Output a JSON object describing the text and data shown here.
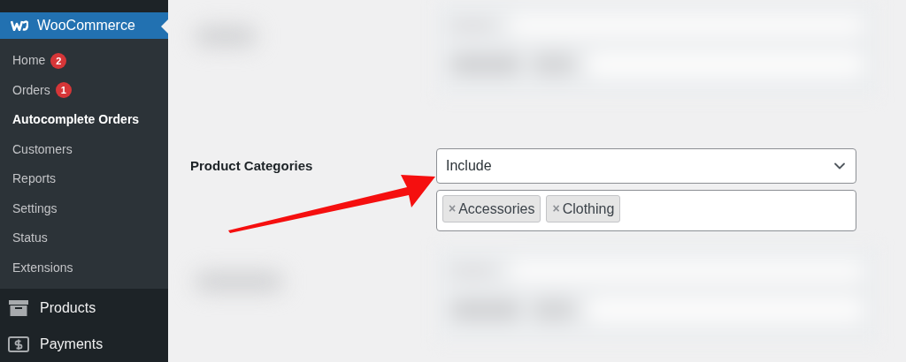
{
  "sidebar": {
    "menu": {
      "label": "WooCommerce",
      "selected": true
    },
    "submenu": [
      {
        "label": "Home",
        "badge": "2",
        "selected": false
      },
      {
        "label": "Orders",
        "badge": "1",
        "selected": false
      },
      {
        "label": "Autocomplete Orders",
        "selected": true
      },
      {
        "label": "Customers",
        "selected": false
      },
      {
        "label": "Reports",
        "selected": false
      },
      {
        "label": "Settings",
        "selected": false
      },
      {
        "label": "Status",
        "selected": false
      },
      {
        "label": "Extensions",
        "selected": false
      }
    ],
    "items": [
      {
        "label": "Products"
      },
      {
        "label": "Payments"
      }
    ]
  },
  "field": {
    "label": "Product Categories",
    "mode": {
      "value": "Include"
    },
    "tags": [
      {
        "remove": "×",
        "label": "Accessories"
      },
      {
        "remove": "×",
        "label": "Clothing"
      }
    ]
  }
}
